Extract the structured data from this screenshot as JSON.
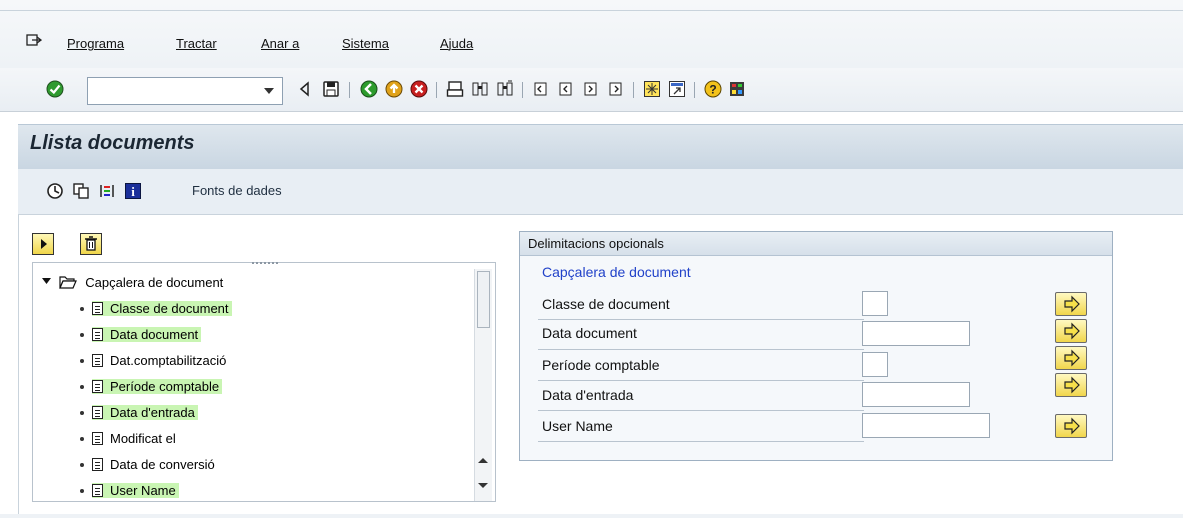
{
  "menu": {
    "items": [
      "Programa",
      "Tractar",
      "Anar a",
      "Sistema",
      "Ajuda"
    ]
  },
  "toolbar": {
    "command_field_value": "",
    "icons": [
      "enter-check-icon",
      "back-triangle-icon",
      "save-icon",
      "back-green-icon",
      "exit-yellow-icon",
      "cancel-red-icon",
      "print-icon",
      "find-icon",
      "find-next-icon",
      "first-page-icon",
      "previous-page-icon",
      "next-page-icon",
      "last-page-icon",
      "create-session-icon",
      "shortcut-icon",
      "help-icon",
      "layout-icon"
    ]
  },
  "page": {
    "title": "Llista documents"
  },
  "app_toolbar": {
    "icons": [
      "execute-icon",
      "copy-icon",
      "selection-options-icon",
      "info-icon"
    ],
    "fonts_label": "Fonts de dades"
  },
  "tree": {
    "buttons": [
      "expand-button",
      "delete-button"
    ],
    "root": "Capçalera de document",
    "items": [
      {
        "label": "Classe de document",
        "highlighted": true
      },
      {
        "label": "Data document",
        "highlighted": true
      },
      {
        "label": "Dat.comptabilització",
        "highlighted": false
      },
      {
        "label": "Període comptable",
        "highlighted": true
      },
      {
        "label": "Data d'entrada",
        "highlighted": true
      },
      {
        "label": "Modificat el",
        "highlighted": false
      },
      {
        "label": "Data de conversió",
        "highlighted": false
      },
      {
        "label": "User Name",
        "highlighted": true
      }
    ]
  },
  "delimitations": {
    "title": "Delimitacions opcionals",
    "subtitle": "Capçalera de document",
    "fields": [
      {
        "label": "Classe de document",
        "value": ""
      },
      {
        "label": "Data document",
        "value": ""
      },
      {
        "label": "Període comptable",
        "value": ""
      },
      {
        "label": "Data d'entrada",
        "value": ""
      },
      {
        "label": "User Name",
        "value": ""
      }
    ]
  },
  "colors": {
    "highlight": "#c9f5b3",
    "title_band": "#cfdbe6",
    "subtitle_blue": "#2142c9",
    "button_yellow": "#f1d64c"
  }
}
